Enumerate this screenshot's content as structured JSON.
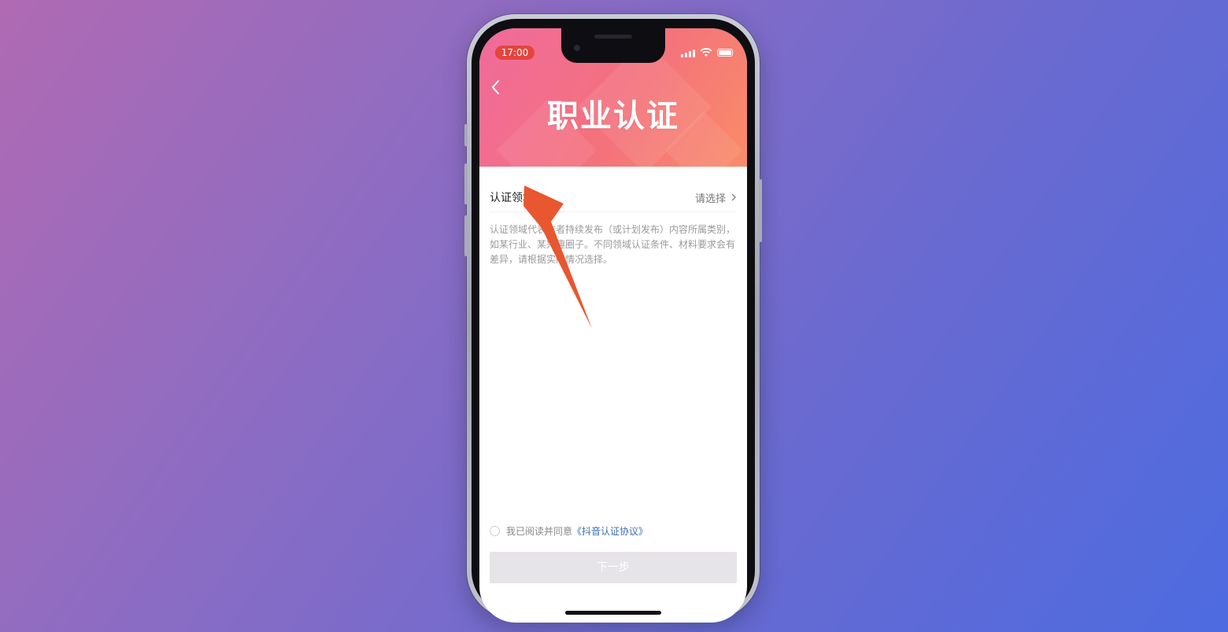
{
  "status_bar": {
    "time": "17:00"
  },
  "header": {
    "title": "职业认证",
    "gradient": [
      "#f06a9c",
      "#f98c68"
    ]
  },
  "field": {
    "label": "认证领域",
    "value": "请选择"
  },
  "description": "认证领域代表作者持续发布（或计划发布）内容所属类别，如某行业、某兴趣圈子。不同领域认证条件、材料要求会有差异，请根据实际情况选择。",
  "agreement": {
    "prefix": "我已阅读并同意",
    "link": "《抖音认证协议》"
  },
  "next_button": {
    "label": "下一步"
  },
  "colors": {
    "accent_arrow": "#e8572f",
    "link": "#3a6fb0",
    "time_pill": "#e4453f"
  },
  "icons": [
    "back-chevron-icon",
    "chevron-right-icon",
    "signal-icon",
    "wifi-icon",
    "battery-icon"
  ]
}
